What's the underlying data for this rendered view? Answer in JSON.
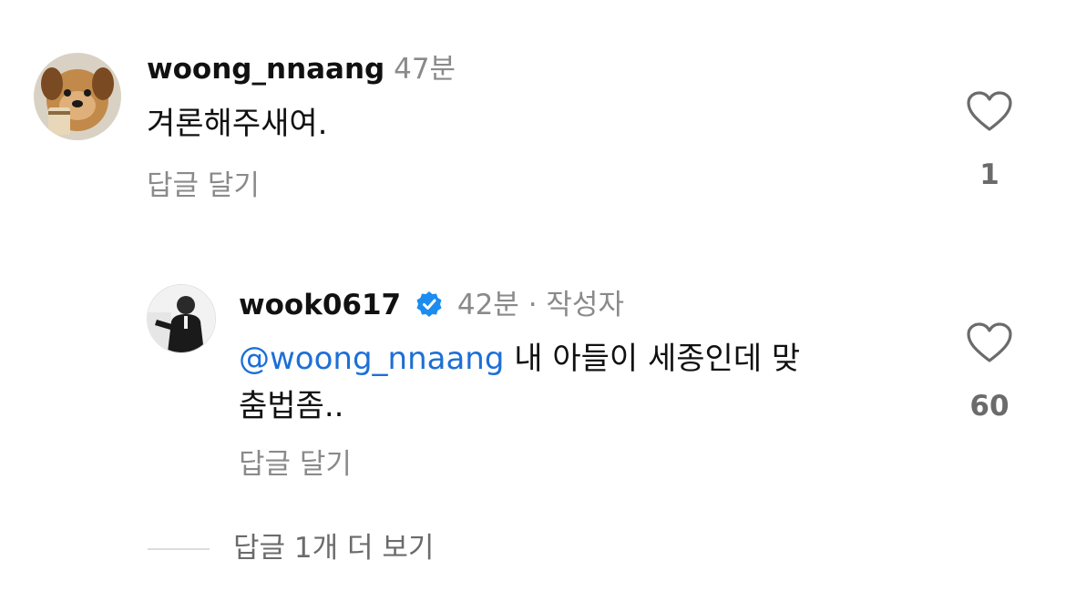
{
  "comments": [
    {
      "username": "woong_nnaang",
      "time": "47분",
      "text": "겨론해주새여.",
      "reply_label": "답글 달기",
      "like_count": "1",
      "avatar_icon": "puppy-avatar"
    }
  ],
  "reply": {
    "username": "wook0617",
    "verified_icon": "verified-badge-icon",
    "time": "42분",
    "separator": "·",
    "author_tag": "작성자",
    "mention": "@woong_nnaang",
    "text": "내 아들이 세종인데 맞\n춤법좀..",
    "reply_label": "답글 달기",
    "like_count": "60",
    "avatar_icon": "man-in-suit-avatar"
  },
  "view_more_replies": "답글 1개 더 보기",
  "colors": {
    "mention": "#1d6fd6",
    "verified": "#1d8cf0",
    "muted": "#8a8a8a"
  }
}
